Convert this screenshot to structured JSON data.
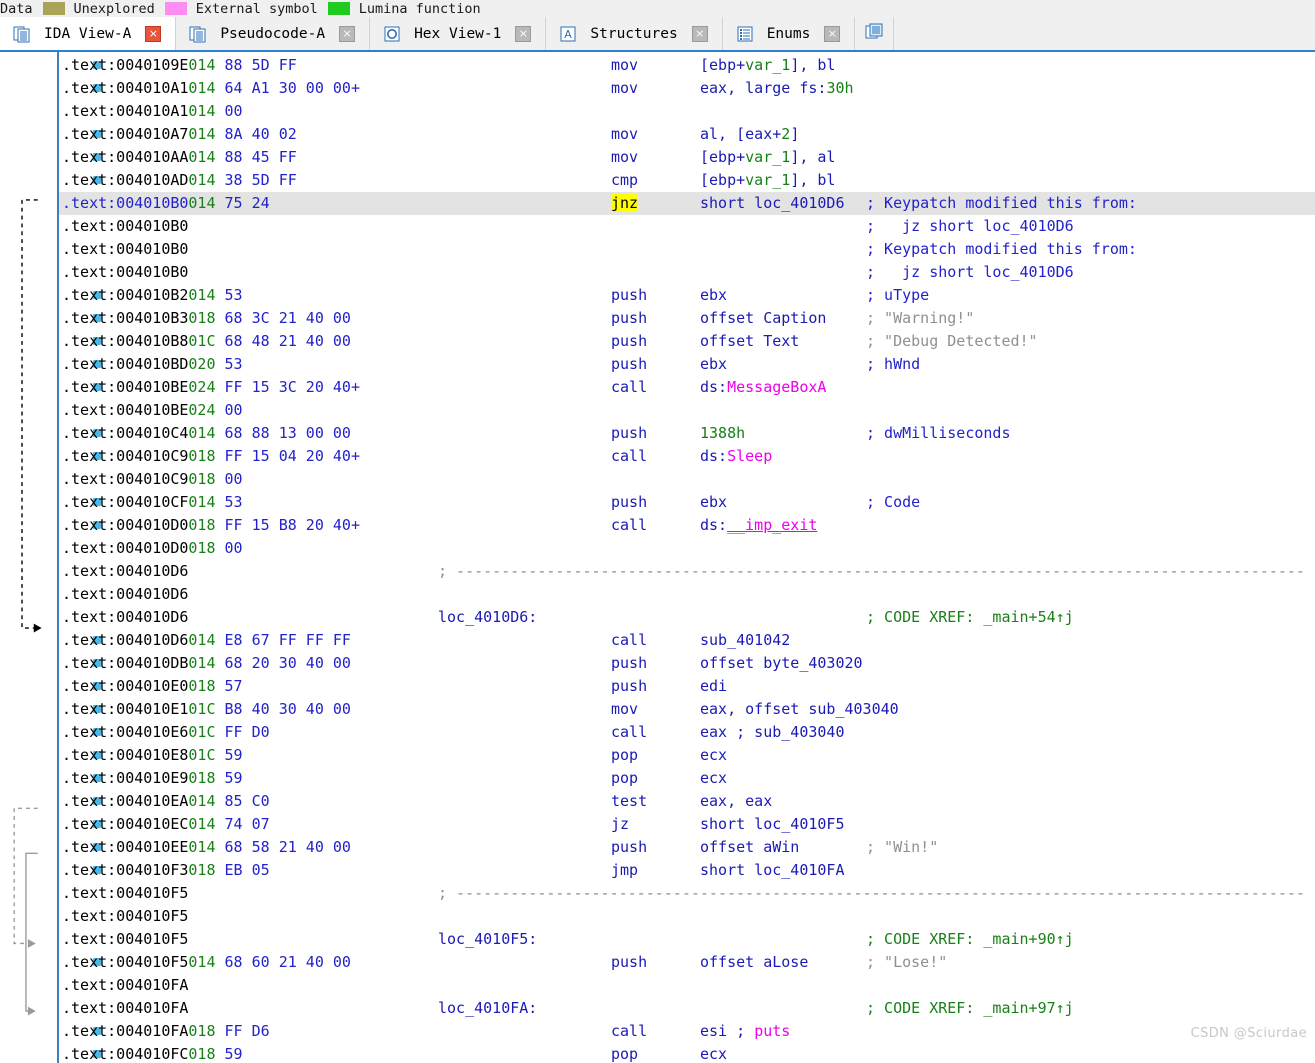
{
  "legend": {
    "items": [
      {
        "label": "Data",
        "swatch": null
      },
      {
        "label": "Unexplored",
        "swatch": "#aaa457"
      },
      {
        "label": "External symbol",
        "swatch": "#ff8cf0"
      },
      {
        "label": "Lumina function",
        "swatch": "#1ecb1e"
      }
    ]
  },
  "tabs": [
    {
      "label": "IDA View-A",
      "icon": "document-pages-icon",
      "active": true,
      "close": "×"
    },
    {
      "label": "Pseudocode-A",
      "icon": "document-pages-icon",
      "active": false,
      "close": "×"
    },
    {
      "label": "Hex View-1",
      "icon": "hex-circle-icon",
      "active": false,
      "close": "×"
    },
    {
      "label": "Structures",
      "icon": "letter-a-box-icon",
      "active": false,
      "close": "×"
    },
    {
      "label": "Enums",
      "icon": "list-lines-icon",
      "active": false,
      "close": "×"
    }
  ],
  "tab_overflow_icon": "more-views-icon",
  "colors": {
    "accent": "#2f7fd0",
    "highlight": "#ffff00",
    "current_line": "#e3e3e3",
    "address": "#000000",
    "stack_depth": "#178117",
    "hex_bytes": "#2222cc",
    "mnemonic": "#1a1ab5",
    "external_symbol": "#ee00ee",
    "comment": "#2222cc",
    "string_comment": "#909090",
    "xref_comment": "#178117",
    "gutter_dot": "#4db8e8"
  },
  "watermark": "CSDN @Sciurdae",
  "disassembly": {
    "section": ".text",
    "lines": [
      {
        "addr": ".text:0040109E",
        "stack": "014",
        "hex": "88 5D FF",
        "mnem": "mov",
        "op": "[ebp+var_1], bl",
        "cmt": "",
        "dot": true
      },
      {
        "addr": ".text:004010A1",
        "stack": "014",
        "hex": "64 A1 30 00 00+",
        "mnem": "mov",
        "op": "eax, large fs:30h",
        "cmt": "",
        "dot": true
      },
      {
        "addr": ".text:004010A1",
        "stack": "014",
        "hex": "00",
        "mnem": "",
        "op": "",
        "cmt": "",
        "dot": false
      },
      {
        "addr": ".text:004010A7",
        "stack": "014",
        "hex": "8A 40 02",
        "mnem": "mov",
        "op": "al, [eax+2]",
        "cmt": "",
        "dot": true
      },
      {
        "addr": ".text:004010AA",
        "stack": "014",
        "hex": "88 45 FF",
        "mnem": "mov",
        "op": "[ebp+var_1], al",
        "cmt": "",
        "dot": true
      },
      {
        "addr": ".text:004010AD",
        "stack": "014",
        "hex": "38 5D FF",
        "mnem": "cmp",
        "op": "[ebp+var_1], bl",
        "cmt": "",
        "dot": true
      },
      {
        "addr": ".text:004010B0",
        "stack": "014",
        "hex": "75 24",
        "mnem": "jnz",
        "op": "short loc_4010D6",
        "cmt": "; Keypatch modified this from:",
        "dot": true,
        "current": true,
        "hl_mnem": true
      },
      {
        "addr": ".text:004010B0",
        "stack": "",
        "hex": "",
        "mnem": "",
        "op": "",
        "cmt": ";   jz short loc_4010D6",
        "dot": false
      },
      {
        "addr": ".text:004010B0",
        "stack": "",
        "hex": "",
        "mnem": "",
        "op": "",
        "cmt": "; Keypatch modified this from:",
        "dot": false
      },
      {
        "addr": ".text:004010B0",
        "stack": "",
        "hex": "",
        "mnem": "",
        "op": "",
        "cmt": ";   jz short loc_4010D6",
        "dot": false
      },
      {
        "addr": ".text:004010B2",
        "stack": "014",
        "hex": "53",
        "mnem": "push",
        "op": "ebx",
        "cmt": "; uType",
        "dot": true
      },
      {
        "addr": ".text:004010B3",
        "stack": "018",
        "hex": "68 3C 21 40 00",
        "mnem": "push",
        "op": "offset Caption",
        "cmt": "; \"Warning!\"",
        "str": true,
        "dot": true
      },
      {
        "addr": ".text:004010B8",
        "stack": "01C",
        "hex": "68 48 21 40 00",
        "mnem": "push",
        "op": "offset Text",
        "cmt": "; \"Debug Detected!\"",
        "str": true,
        "dot": true
      },
      {
        "addr": ".text:004010BD",
        "stack": "020",
        "hex": "53",
        "mnem": "push",
        "op": "ebx",
        "cmt": "; hWnd",
        "dot": true
      },
      {
        "addr": ".text:004010BE",
        "stack": "024",
        "hex": "FF 15 3C 20 40+",
        "mnem": "call",
        "op": "ds:MessageBoxA",
        "cmt": "",
        "ext": "MessageBoxA",
        "dot": true
      },
      {
        "addr": ".text:004010BE",
        "stack": "024",
        "hex": "00",
        "mnem": "",
        "op": "",
        "cmt": "",
        "dot": false
      },
      {
        "addr": ".text:004010C4",
        "stack": "014",
        "hex": "68 88 13 00 00",
        "mnem": "push",
        "op": "1388h",
        "cmt": "; dwMilliseconds",
        "num": true,
        "dot": true
      },
      {
        "addr": ".text:004010C9",
        "stack": "018",
        "hex": "FF 15 04 20 40+",
        "mnem": "call",
        "op": "ds:Sleep",
        "cmt": "",
        "ext": "Sleep",
        "dot": true
      },
      {
        "addr": ".text:004010C9",
        "stack": "018",
        "hex": "00",
        "mnem": "",
        "op": "",
        "cmt": "",
        "dot": false
      },
      {
        "addr": ".text:004010CF",
        "stack": "014",
        "hex": "53",
        "mnem": "push",
        "op": "ebx",
        "cmt": "; Code",
        "dot": true
      },
      {
        "addr": ".text:004010D0",
        "stack": "018",
        "hex": "FF 15 B8 20 40+",
        "mnem": "call",
        "op": "ds:__imp_exit",
        "cmt": "",
        "ext": "__imp_exit",
        "underline": true,
        "dot": true
      },
      {
        "addr": ".text:004010D0",
        "stack": "018",
        "hex": "00",
        "mnem": "",
        "op": "",
        "cmt": "",
        "dot": false
      },
      {
        "addr": ".text:004010D6",
        "stack": "",
        "hex": "",
        "separator": true,
        "dot": false
      },
      {
        "addr": ".text:004010D6",
        "stack": "",
        "hex": "",
        "mnem": "",
        "op": "",
        "cmt": "",
        "dot": false
      },
      {
        "addr": ".text:004010D6",
        "stack": "",
        "hex": "",
        "label": "loc_4010D6:",
        "cmt": "; CODE XREF: _main+54↑j",
        "xref": true,
        "dot": false
      },
      {
        "addr": ".text:004010D6",
        "stack": "014",
        "hex": "E8 67 FF FF FF",
        "mnem": "call",
        "op": "sub_401042",
        "cmt": "",
        "dot": true,
        "arrow_target": true
      },
      {
        "addr": ".text:004010DB",
        "stack": "014",
        "hex": "68 20 30 40 00",
        "mnem": "push",
        "op": "offset byte_403020",
        "cmt": "",
        "dot": true
      },
      {
        "addr": ".text:004010E0",
        "stack": "018",
        "hex": "57",
        "mnem": "push",
        "op": "edi",
        "cmt": "",
        "dot": true
      },
      {
        "addr": ".text:004010E1",
        "stack": "01C",
        "hex": "B8 40 30 40 00",
        "mnem": "mov",
        "op": "eax, offset sub_403040",
        "cmt": "",
        "dot": true
      },
      {
        "addr": ".text:004010E6",
        "stack": "01C",
        "hex": "FF D0",
        "mnem": "call",
        "op": "eax ; sub_403040",
        "cmt": "",
        "dot": true
      },
      {
        "addr": ".text:004010E8",
        "stack": "01C",
        "hex": "59",
        "mnem": "pop",
        "op": "ecx",
        "cmt": "",
        "dot": true
      },
      {
        "addr": ".text:004010E9",
        "stack": "018",
        "hex": "59",
        "mnem": "pop",
        "op": "ecx",
        "cmt": "",
        "dot": true
      },
      {
        "addr": ".text:004010EA",
        "stack": "014",
        "hex": "85 C0",
        "mnem": "test",
        "op": "eax, eax",
        "cmt": "",
        "dot": true
      },
      {
        "addr": ".text:004010EC",
        "stack": "014",
        "hex": "74 07",
        "mnem": "jz",
        "op": "short loc_4010F5",
        "cmt": "",
        "dot": true
      },
      {
        "addr": ".text:004010EE",
        "stack": "014",
        "hex": "68 58 21 40 00",
        "mnem": "push",
        "op": "offset aWin",
        "cmt": "; \"Win!\"",
        "str": true,
        "dot": true
      },
      {
        "addr": ".text:004010F3",
        "stack": "018",
        "hex": "EB 05",
        "mnem": "jmp",
        "op": "short loc_4010FA",
        "cmt": "",
        "dot": true
      },
      {
        "addr": ".text:004010F5",
        "stack": "",
        "hex": "",
        "separator": true,
        "dot": false
      },
      {
        "addr": ".text:004010F5",
        "stack": "",
        "hex": "",
        "mnem": "",
        "op": "",
        "cmt": "",
        "dot": false
      },
      {
        "addr": ".text:004010F5",
        "stack": "",
        "hex": "",
        "label": "loc_4010F5:",
        "cmt": "; CODE XREF: _main+90↑j",
        "xref": true,
        "dot": false
      },
      {
        "addr": ".text:004010F5",
        "stack": "014",
        "hex": "68 60 21 40 00",
        "mnem": "push",
        "op": "offset aLose",
        "cmt": "; \"Lose!\"",
        "str": true,
        "dot": true
      },
      {
        "addr": ".text:004010FA",
        "stack": "",
        "hex": "",
        "mnem": "",
        "op": "",
        "cmt": "",
        "dot": false
      },
      {
        "addr": ".text:004010FA",
        "stack": "",
        "hex": "",
        "label": "loc_4010FA:",
        "cmt": "; CODE XREF: _main+97↑j",
        "xref": true,
        "dot": false
      },
      {
        "addr": ".text:004010FA",
        "stack": "018",
        "hex": "FF D6",
        "mnem": "call",
        "op": "esi ; puts",
        "cmt": "",
        "ext_tail": "puts",
        "dot": true
      },
      {
        "addr": ".text:004010FC",
        "stack": "018",
        "hex": "59",
        "mnem": "pop",
        "op": "ecx",
        "cmt": "",
        "dot": true
      }
    ]
  }
}
